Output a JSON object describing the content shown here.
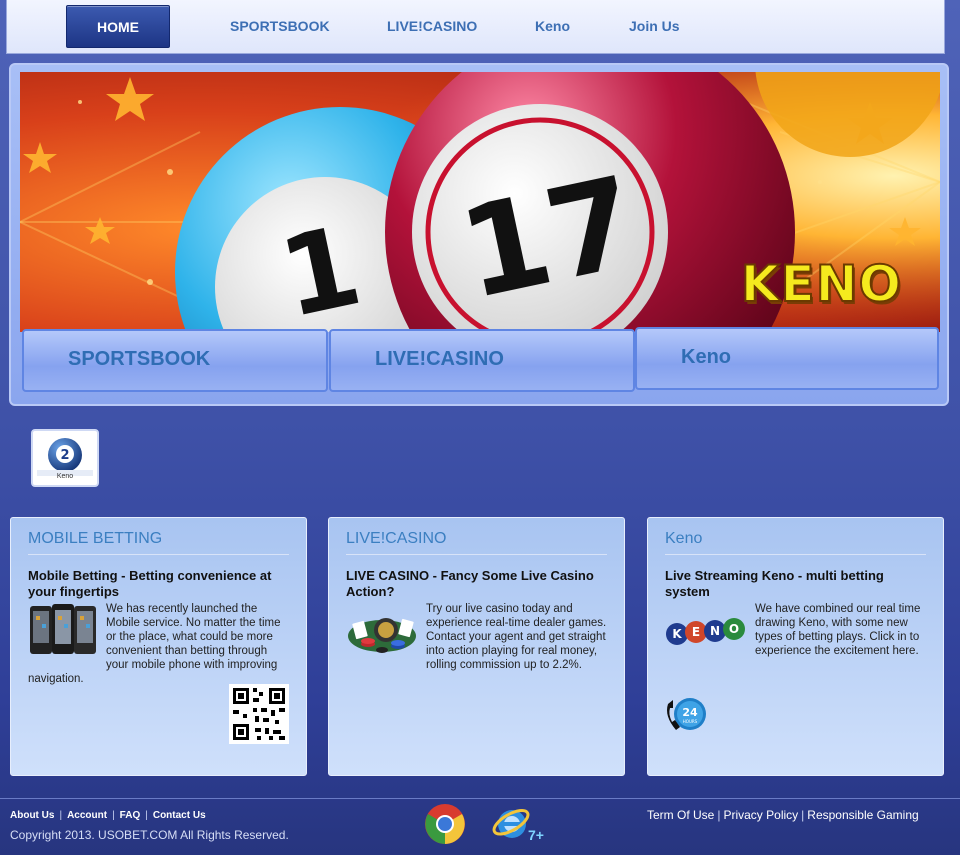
{
  "nav": {
    "home": "HOME",
    "items": [
      "SPORTSBOOK",
      "LIVE!CASINO",
      "Keno",
      "Join Us"
    ]
  },
  "hero": {
    "banner_text": "KENO",
    "ball_numbers": [
      "1",
      "17"
    ],
    "tabs": [
      "SPORTSBOOK",
      "LIVE!CASINO",
      "Keno"
    ]
  },
  "badge": {
    "number": "2",
    "label": "Keno"
  },
  "panels": [
    {
      "title": "MOBILE BETTING",
      "heading": "Mobile Betting - Betting convenience at your fingertips",
      "body": "We has recently launched the Mobile service. No matter the time or the place, what could be more convenient than betting through your mobile phone with improving navigation."
    },
    {
      "title": "LIVE!CASINO",
      "heading": "LIVE CASINO - Fancy Some Live Casino Action?",
      "body": "Try our live casino today and experience real-time dealer games. Contact your agent and get straight into action playing for real money, rolling commission up to 2.2%."
    },
    {
      "title": "Keno",
      "heading": "Live Streaming Keno - multi betting system",
      "body": "We have combined our real time drawing Keno, with some new types of betting plays. Click in to experience the excitement here.",
      "logo_letters": [
        "K",
        "E",
        "N",
        "O"
      ],
      "support_number": "24",
      "support_text": "HOURS"
    }
  ],
  "footer": {
    "links": [
      "About Us",
      "Account",
      "FAQ",
      "Contact Us"
    ],
    "copyright": "Copyright 2013. USOBET.COM All Rights Reserved.",
    "ie_version": "7+",
    "right_links": [
      "Term Of Use",
      "Privacy Policy",
      "Responsible Gaming"
    ]
  },
  "colors": {
    "nav_text": "#3d6fb4",
    "accent": "#2f6db4",
    "panel_title": "#3b7fc1",
    "banner_bg": "#d8401a",
    "ball_blue": "#2fb3ea",
    "ball_red": "#b3123a"
  },
  "icons": [
    "chrome-icon",
    "internet-explorer-icon",
    "phone-24h-icon",
    "qr-code-icon",
    "mobile-phones-image",
    "casino-chips-image",
    "keno-ball-icon"
  ]
}
